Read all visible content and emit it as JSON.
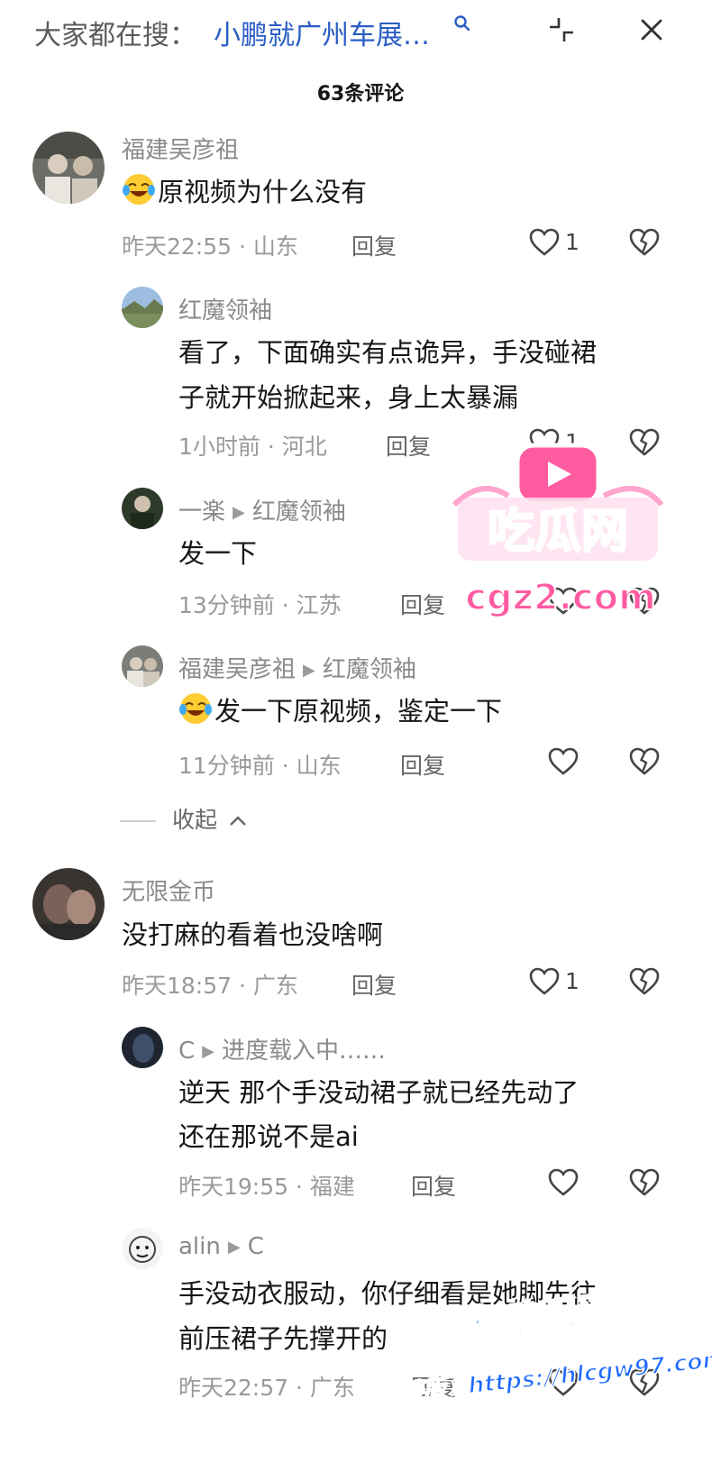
{
  "header": {
    "search_prefix": "大家都在搜：",
    "search_query": "小鹏就广州车展…",
    "comment_count": "63条评论"
  },
  "comments": [
    {
      "user": "福建吴彦祖",
      "text": "原视频为什么没有",
      "time_location": "昨天22:55 · 山东",
      "reply_label": "回复",
      "likes": "1",
      "replies": [
        {
          "user": "红魔领袖",
          "text_lines": [
            "看了，下面确实有点诡异，手没碰裙",
            "子就开始掀起来，身上太暴漏"
          ],
          "time_location": "1小时前 · 河北",
          "reply_label": "回复",
          "likes": "1"
        },
        {
          "user": "一楽",
          "reply_to": "红魔领袖",
          "text": "发一下",
          "time_location": "13分钟前 · 江苏",
          "reply_label": "回复"
        },
        {
          "user": "福建吴彦祖",
          "reply_to": "红魔领袖",
          "text": "发一下原视频，鉴定一下",
          "time_location": "11分钟前 · 山东",
          "reply_label": "回复"
        }
      ],
      "collapse_label": "收起"
    },
    {
      "user": "无限金币",
      "text": "没打麻的看着也没啥啊",
      "time_location": "昨天18:57 · 广东",
      "reply_label": "回复",
      "likes": "1",
      "replies": [
        {
          "user": "C",
          "reply_to": "进度载入中……",
          "text_lines": [
            "逆天 那个手没动裙子就已经先动了",
            "还在那说不是ai"
          ],
          "time_location": "昨天19:55 · 福建",
          "reply_label": "回复"
        },
        {
          "user": "alin",
          "reply_to": "C",
          "text_lines": [
            "手没动衣服动，你仔细看是她脚先往",
            "前压裙子先撑开的"
          ],
          "time_location": "昨天22:57 · 广东",
          "reply_label": "回复"
        }
      ]
    }
  ],
  "watermarks": {
    "logo_text": "吃瓜网",
    "logo_url": "cgz2.com",
    "bottom_brand": "黑料吃瓜网",
    "bottom_url": "看完整版：https://hlcgw97.com"
  },
  "colors": {
    "link_blue": "#2a5dc5",
    "meta_gray": "#9a9a9a",
    "watermark_pink": "#ff5ba1",
    "watermark_blue": "#1f6bff"
  }
}
